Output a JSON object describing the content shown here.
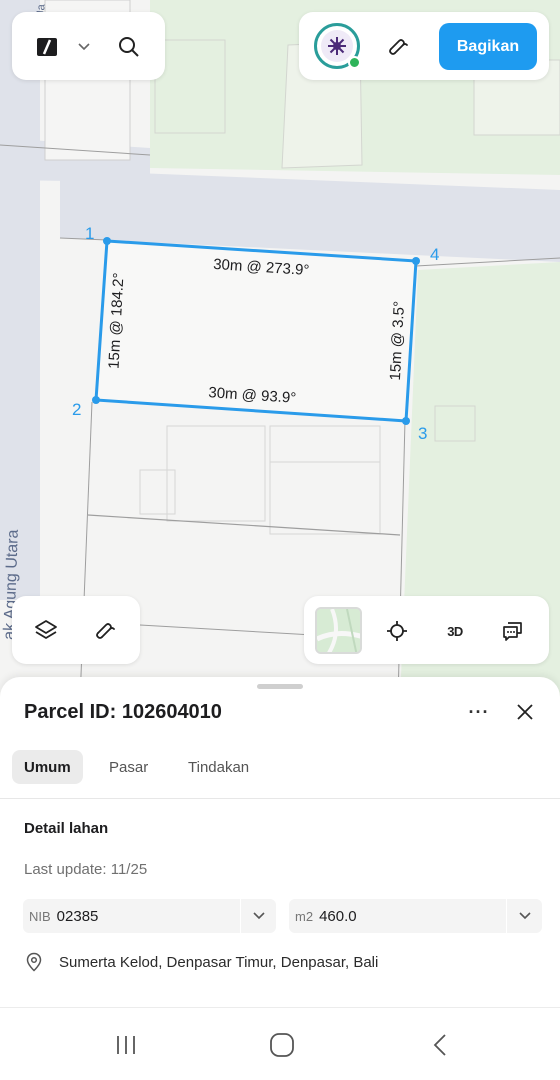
{
  "map": {
    "street_label": "Jl. Gunung Agung Utara",
    "street_label_visible": "ak Agung Utara",
    "road_label_top": "Ja",
    "parcel": {
      "vertices": [
        "1",
        "2",
        "3",
        "4"
      ],
      "edges": {
        "top": "30m @ 273.9°",
        "bottom": "30m @ 93.9°",
        "left": "15m @ 184.2°",
        "right": "15m @ 3.5°"
      },
      "color": "#2a9bea"
    }
  },
  "top_bar": {
    "logo_icon": "app-logo-icon",
    "share_label": "Bagikan",
    "accent": "#1e9bf0"
  },
  "sheet": {
    "title": "Parcel ID: 102604010",
    "more": "···",
    "tabs": [
      {
        "label": "Umum",
        "active": true
      },
      {
        "label": "Pasar",
        "active": false
      },
      {
        "label": "Tindakan",
        "active": false
      }
    ],
    "section_title": "Detail lahan",
    "last_update": "Last update: 11/25",
    "nib": {
      "prefix": "NIB",
      "value": "02385"
    },
    "area": {
      "prefix": "m2",
      "value": "460.0"
    },
    "address": "Sumerta Kelod, Denpasar Timur, Denpasar, Bali"
  }
}
